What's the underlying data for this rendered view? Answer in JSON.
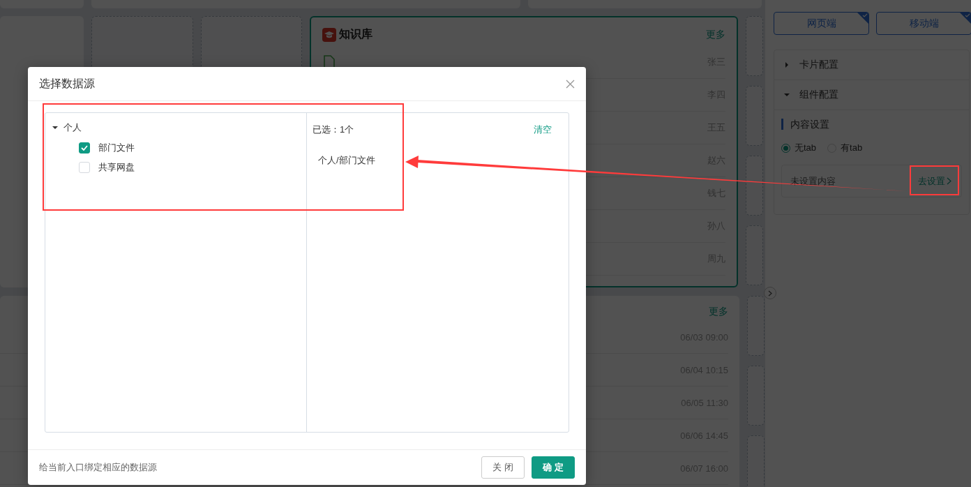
{
  "dashboard": {
    "knowledge_card": {
      "title": "知识库",
      "more": "更多",
      "rows": [
        {
          "name": "张三"
        },
        {
          "name": "李四"
        },
        {
          "name": "王五"
        },
        {
          "name": "赵六"
        },
        {
          "name": "钱七"
        },
        {
          "name": "孙八"
        },
        {
          "name": "周九"
        }
      ]
    },
    "schedule_card": {
      "more": "更多",
      "rows": [
        {
          "time": "06/03 09:00"
        },
        {
          "time": "06/04 10:15"
        },
        {
          "time": "06/05 11:30"
        },
        {
          "time": "06/06 14:45"
        },
        {
          "time": "06/07 16:00"
        }
      ]
    }
  },
  "side_panel": {
    "platforms": [
      {
        "label": "网页端",
        "selected": true
      },
      {
        "label": "移动端",
        "selected": true
      }
    ],
    "sections": [
      {
        "title": "卡片配置",
        "expanded": false
      },
      {
        "title": "组件配置",
        "expanded": true
      }
    ],
    "content_heading": "内容设置",
    "tab_options": [
      {
        "label": "无tab",
        "selected": true
      },
      {
        "label": "有tab",
        "selected": false
      }
    ],
    "empty_text": "未设置内容",
    "setup_link": "去设置"
  },
  "dialog": {
    "title": "选择数据源",
    "tree": [
      {
        "label": "个人",
        "expanded": true,
        "children": [
          {
            "label": "部门文件",
            "checked": true
          },
          {
            "label": "共享网盘",
            "checked": false
          }
        ]
      }
    ],
    "selected_count": "已选：1个",
    "clear": "清空",
    "selected_items": [
      "个人/部门文件"
    ],
    "hint": "给当前入口绑定相应的数据源",
    "buttons": [
      {
        "label": "关 闭",
        "kind": "default"
      },
      {
        "label": "确 定",
        "kind": "primary"
      }
    ]
  }
}
